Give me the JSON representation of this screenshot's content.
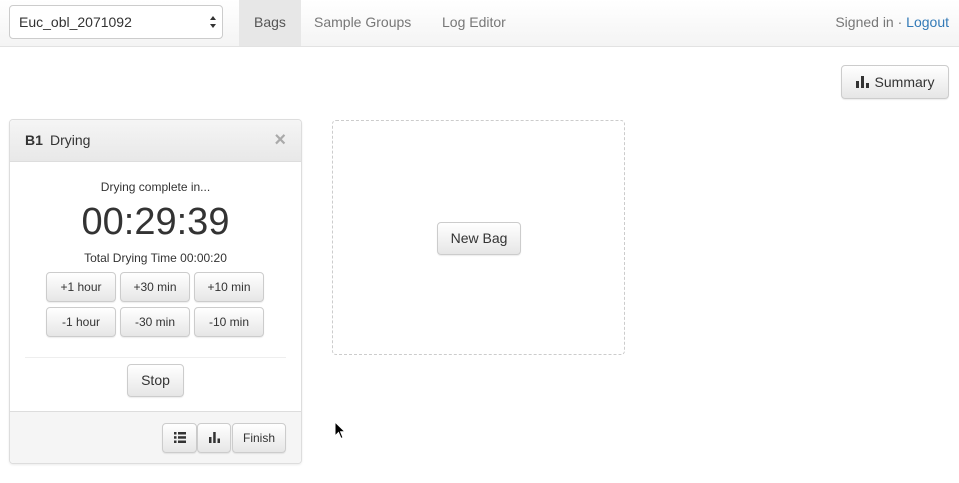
{
  "navbar": {
    "project_select": {
      "value": "Euc_obl_2071092"
    },
    "tabs": [
      {
        "label": "Bags",
        "active": true
      },
      {
        "label": "Sample Groups",
        "active": false
      },
      {
        "label": "Log Editor",
        "active": false
      }
    ],
    "signed_in_text": "Signed in · ",
    "logout_label": "Logout"
  },
  "toolbar": {
    "summary_label": "Summary",
    "summary_icon": "bar-chart-icon"
  },
  "bag_panel": {
    "bag_id": "B1",
    "status": "Drying",
    "close_symbol": "×",
    "countdown_caption": "Drying complete in...",
    "countdown": "00:29:39",
    "total_drying_text": "Total Drying Time 00:00:20",
    "adjust_buttons_row1": [
      "+1 hour",
      "+30 min",
      "+10 min"
    ],
    "adjust_buttons_row2": [
      "-1 hour",
      "-30 min",
      "-10 min"
    ],
    "stop_label": "Stop",
    "footer": {
      "list_icon": "list-icon",
      "chart_icon": "bar-chart-icon",
      "finish_label": "Finish"
    }
  },
  "new_bag": {
    "label": "New Bag"
  },
  "colors": {
    "link": "#337ab7",
    "active_tab_bg": "#e7e7e7",
    "panel_heading_bg": "#eeeeee"
  }
}
